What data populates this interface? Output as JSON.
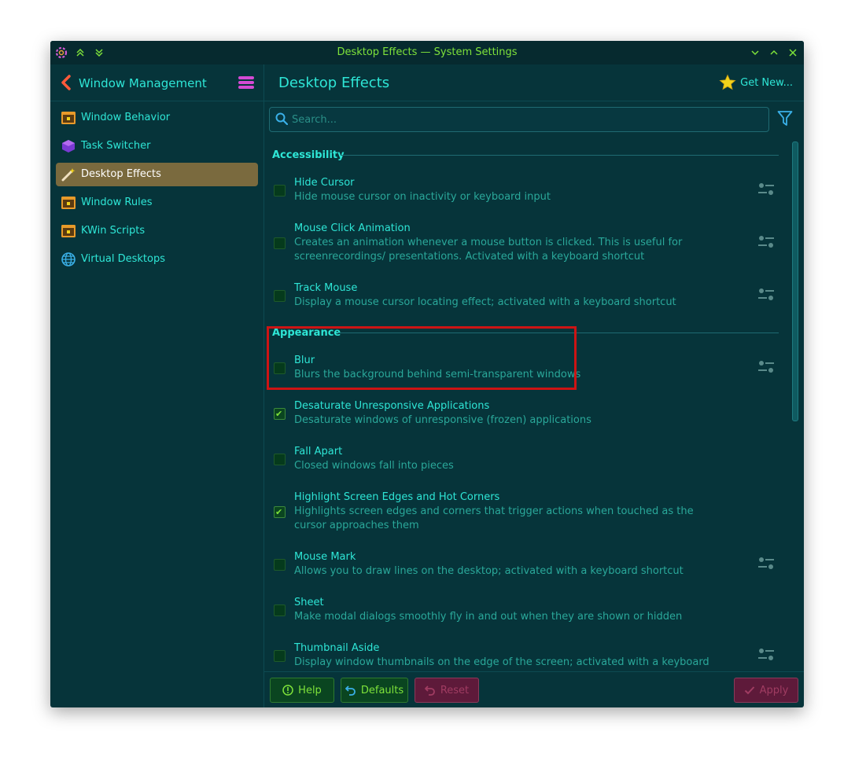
{
  "window": {
    "title": "Desktop Effects — System Settings"
  },
  "header": {
    "back_title": "Window Management",
    "page_title": "Desktop Effects",
    "get_new": "Get New..."
  },
  "sidebar": {
    "items": [
      {
        "label": "Window Behavior",
        "icon": "window-behavior-icon",
        "active": false
      },
      {
        "label": "Task Switcher",
        "icon": "task-switcher-icon",
        "active": false
      },
      {
        "label": "Desktop Effects",
        "icon": "desktop-effects-icon",
        "active": true
      },
      {
        "label": "Window Rules",
        "icon": "window-rules-icon",
        "active": false
      },
      {
        "label": "KWin Scripts",
        "icon": "kwin-scripts-icon",
        "active": false
      },
      {
        "label": "Virtual Desktops",
        "icon": "virtual-desktops-icon",
        "active": false
      }
    ]
  },
  "search": {
    "placeholder": "Search..."
  },
  "categories": [
    {
      "name": "Accessibility",
      "effects": [
        {
          "name": "Hide Cursor",
          "description": "Hide mouse cursor on inactivity or keyboard input",
          "checked": false,
          "configurable": true
        },
        {
          "name": "Mouse Click Animation",
          "description": "Creates an animation whenever a mouse button is clicked. This is useful for screenrecordings/ presentations. Activated with a keyboard shortcut",
          "checked": false,
          "configurable": true
        },
        {
          "name": "Track Mouse",
          "description": "Display a mouse cursor locating effect; activated with a keyboard shortcut",
          "checked": false,
          "configurable": true
        }
      ]
    },
    {
      "name": "Appearance",
      "effects": [
        {
          "name": "Blur",
          "description": "Blurs the background behind semi-transparent windows",
          "checked": false,
          "configurable": true
        },
        {
          "name": "Desaturate Unresponsive Applications",
          "description": "Desaturate windows of unresponsive (frozen) applications",
          "checked": true,
          "configurable": false
        },
        {
          "name": "Fall Apart",
          "description": "Closed windows fall into pieces",
          "checked": false,
          "configurable": false
        },
        {
          "name": "Highlight Screen Edges and Hot Corners",
          "description": "Highlights screen edges and corners that trigger actions when touched as the cursor approaches them",
          "checked": true,
          "configurable": false
        },
        {
          "name": "Mouse Mark",
          "description": "Allows you to draw lines on the desktop; activated with a keyboard shortcut",
          "checked": false,
          "configurable": true
        },
        {
          "name": "Sheet",
          "description": "Make modal dialogs smoothly fly in and out when they are shown or hidden",
          "checked": false,
          "configurable": false
        },
        {
          "name": "Thumbnail Aside",
          "description": "Display window thumbnails on the edge of the screen; activated with a keyboard shortcut",
          "checked": false,
          "configurable": true
        }
      ]
    }
  ],
  "footer": {
    "help": "Help",
    "defaults": "Defaults",
    "reset": "Reset",
    "apply": "Apply"
  },
  "colors": {
    "background": "#06343a",
    "accent": "#2ee6d6",
    "title_green": "#7ee23a",
    "active_item": "#7a6a3e",
    "highlight_border": "#cc1414"
  }
}
